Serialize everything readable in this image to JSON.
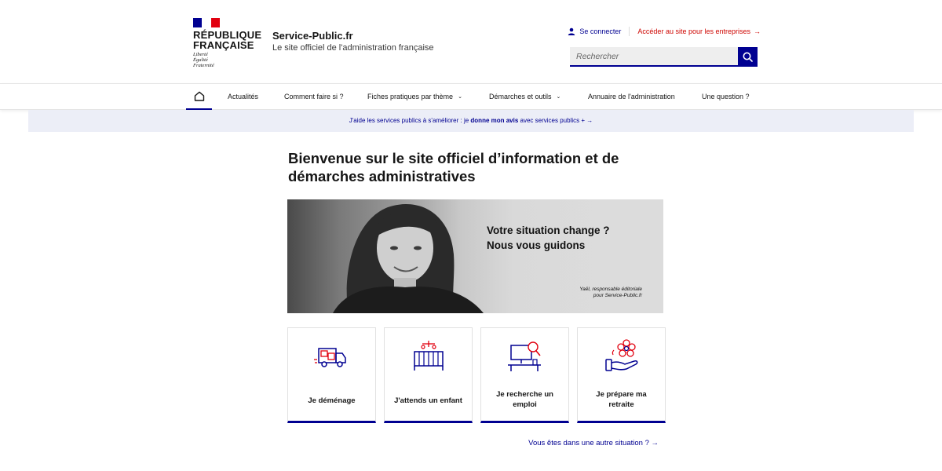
{
  "brand": {
    "republic_line1": "RÉPUBLIQUE",
    "republic_line2": "FRANÇAISE",
    "motto": [
      "Liberté",
      "Égalité",
      "Fraternité"
    ],
    "site_name": "Service-Public.fr",
    "tagline": "Le site officiel de l'administration française",
    "flag_colors": [
      "#000091",
      "#ffffff",
      "#e1000f"
    ]
  },
  "tools": {
    "login_label": "Se connecter",
    "login_icon": "user-icon",
    "business_label": "Accéder au site pour les entreprises",
    "business_arrow": "→"
  },
  "search": {
    "placeholder": "Rechercher",
    "button_icon": "search-icon"
  },
  "nav": {
    "home_icon": "home-icon",
    "items": [
      {
        "label": "Actualités"
      },
      {
        "label": "Comment faire si ?"
      },
      {
        "label": "Fiches pratiques par thème"
      },
      {
        "label": "Démarches et outils"
      },
      {
        "label": "Annuaire de l'administration"
      },
      {
        "label": "Une question ?"
      }
    ]
  },
  "feedback": {
    "pre": "J'aide les services publics à s'améliorer : je ",
    "bold": "donne mon avis",
    "post": " avec services publics + ",
    "arrow": "→"
  },
  "main": {
    "title": "Bienvenue sur le site officiel d’information et de démarches administratives",
    "hero": {
      "line1": "Votre situation change ?",
      "line2": "Nous vous guidons",
      "caption1": "Yaël, responsable éditoriale",
      "caption2": "pour Service-Public.fr"
    },
    "cards": [
      {
        "label": "Je déménage",
        "icon": "moving-truck-icon"
      },
      {
        "label": "J'attends un enfant",
        "icon": "crib-icon"
      },
      {
        "label": "Je recherche un emploi",
        "icon": "job-search-icon"
      },
      {
        "label": "Je prépare ma retraite",
        "icon": "retirement-flower-icon"
      }
    ],
    "other_link": "Vous êtes dans une autre situation ?",
    "other_arrow": "→"
  },
  "colors": {
    "accent_blue": "#000091",
    "accent_red": "#e1000f",
    "banner_bg": "#eceef7"
  }
}
